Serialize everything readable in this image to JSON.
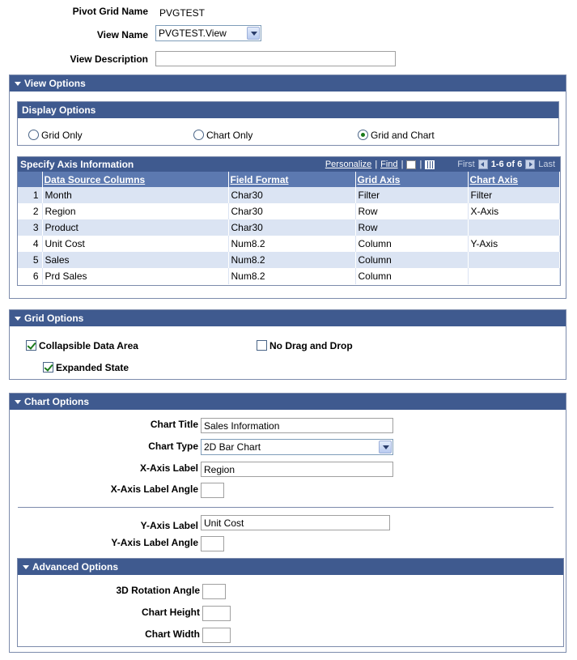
{
  "top": {
    "pivot_grid_name_label": "Pivot Grid Name",
    "pivot_grid_name_value": "PVGTEST",
    "view_name_label": "View Name",
    "view_name_value": "PVGTEST.View",
    "view_description_label": "View Description",
    "view_description_value": ""
  },
  "view_options": {
    "title": "View Options",
    "display_options": {
      "title": "Display Options",
      "options": [
        {
          "label": "Grid Only",
          "selected": false
        },
        {
          "label": "Chart Only",
          "selected": false
        },
        {
          "label": "Grid and Chart",
          "selected": true
        }
      ]
    },
    "axis": {
      "title": "Specify Axis Information",
      "personalize": "Personalize",
      "find": "Find",
      "first": "First",
      "range": "1-6 of 6",
      "last": "Last",
      "columns": [
        "Data Source Columns",
        "Field Format",
        "Grid Axis",
        "Chart Axis"
      ],
      "rows": [
        {
          "n": "1",
          "col": "Month",
          "fmt": "Char30",
          "grid": "Filter",
          "chart": "Filter"
        },
        {
          "n": "2",
          "col": "Region",
          "fmt": "Char30",
          "grid": "Row",
          "chart": "X-Axis"
        },
        {
          "n": "3",
          "col": "Product",
          "fmt": "Char30",
          "grid": "Row",
          "chart": ""
        },
        {
          "n": "4",
          "col": "Unit Cost",
          "fmt": "Num8.2",
          "grid": "Column",
          "chart": "Y-Axis"
        },
        {
          "n": "5",
          "col": "Sales",
          "fmt": "Num8.2",
          "grid": "Column",
          "chart": ""
        },
        {
          "n": "6",
          "col": "Prd Sales",
          "fmt": "Num8.2",
          "grid": "Column",
          "chart": ""
        }
      ]
    }
  },
  "grid_options": {
    "title": "Grid Options",
    "collapsible": {
      "label": "Collapsible Data Area",
      "checked": true
    },
    "no_drag": {
      "label": "No Drag and Drop",
      "checked": false
    },
    "expanded": {
      "label": "Expanded State",
      "checked": true
    }
  },
  "chart_options": {
    "title": "Chart Options",
    "chart_title_label": "Chart Title",
    "chart_title_value": "Sales Information",
    "chart_type_label": "Chart Type",
    "chart_type_value": "2D Bar Chart",
    "x_axis_label_label": "X-Axis Label",
    "x_axis_label_value": "Region",
    "x_axis_angle_label": "X-Axis Label Angle",
    "x_axis_angle_value": "",
    "y_axis_label_label": "Y-Axis Label",
    "y_axis_label_value": "Unit Cost",
    "y_axis_angle_label": "Y-Axis Label Angle",
    "y_axis_angle_value": "",
    "advanced": {
      "title": "Advanced Options",
      "rotation_label": "3D Rotation Angle",
      "rotation_value": "",
      "height_label": "Chart Height",
      "height_value": "",
      "width_label": "Chart Width",
      "width_value": ""
    }
  }
}
